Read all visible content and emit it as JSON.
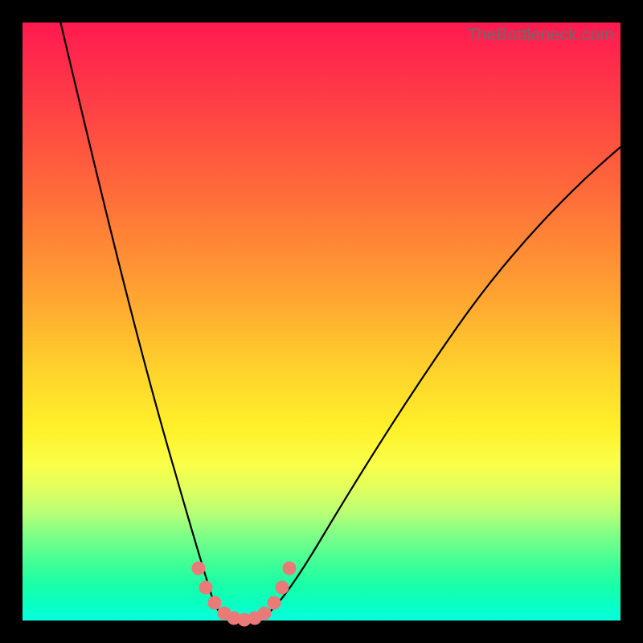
{
  "watermark": "TheBottleneck.com",
  "chart_data": {
    "type": "line",
    "title": "",
    "xlabel": "",
    "ylabel": "",
    "xlim": [
      0,
      100
    ],
    "ylim": [
      0,
      100
    ],
    "grid": false,
    "series": [
      {
        "name": "left-arm",
        "x": [
          6,
          10,
          14,
          18,
          22,
          25.5,
          27.5,
          29,
          30,
          31
        ],
        "values": [
          100,
          83,
          65,
          46,
          28,
          13,
          7,
          4,
          2,
          1
        ]
      },
      {
        "name": "valley",
        "x": [
          31,
          32.5,
          34,
          36,
          38,
          40
        ],
        "values": [
          1,
          0.3,
          0,
          0,
          0.3,
          1
        ]
      },
      {
        "name": "right-arm",
        "x": [
          40,
          42,
          45,
          50,
          56,
          63,
          71,
          80,
          90,
          100
        ],
        "values": [
          1,
          3,
          6.5,
          13,
          22,
          33,
          45,
          57,
          69,
          80
        ]
      }
    ],
    "markers": {
      "name": "highlight-dots",
      "color": "#e97a77",
      "points": [
        {
          "x": 27.3,
          "y": 8.5
        },
        {
          "x": 28.5,
          "y": 5.3
        },
        {
          "x": 30.0,
          "y": 2.8
        },
        {
          "x": 31.5,
          "y": 1.2
        },
        {
          "x": 33.2,
          "y": 0.4
        },
        {
          "x": 35.0,
          "y": 0.2
        },
        {
          "x": 36.8,
          "y": 0.4
        },
        {
          "x": 38.5,
          "y": 1.2
        },
        {
          "x": 40.0,
          "y": 2.8
        },
        {
          "x": 41.3,
          "y": 5.3
        },
        {
          "x": 42.6,
          "y": 8.5
        }
      ]
    },
    "background_gradient": {
      "top": "#ff1a50",
      "mid": "#fff12a",
      "bottom": "#06fedf"
    }
  }
}
